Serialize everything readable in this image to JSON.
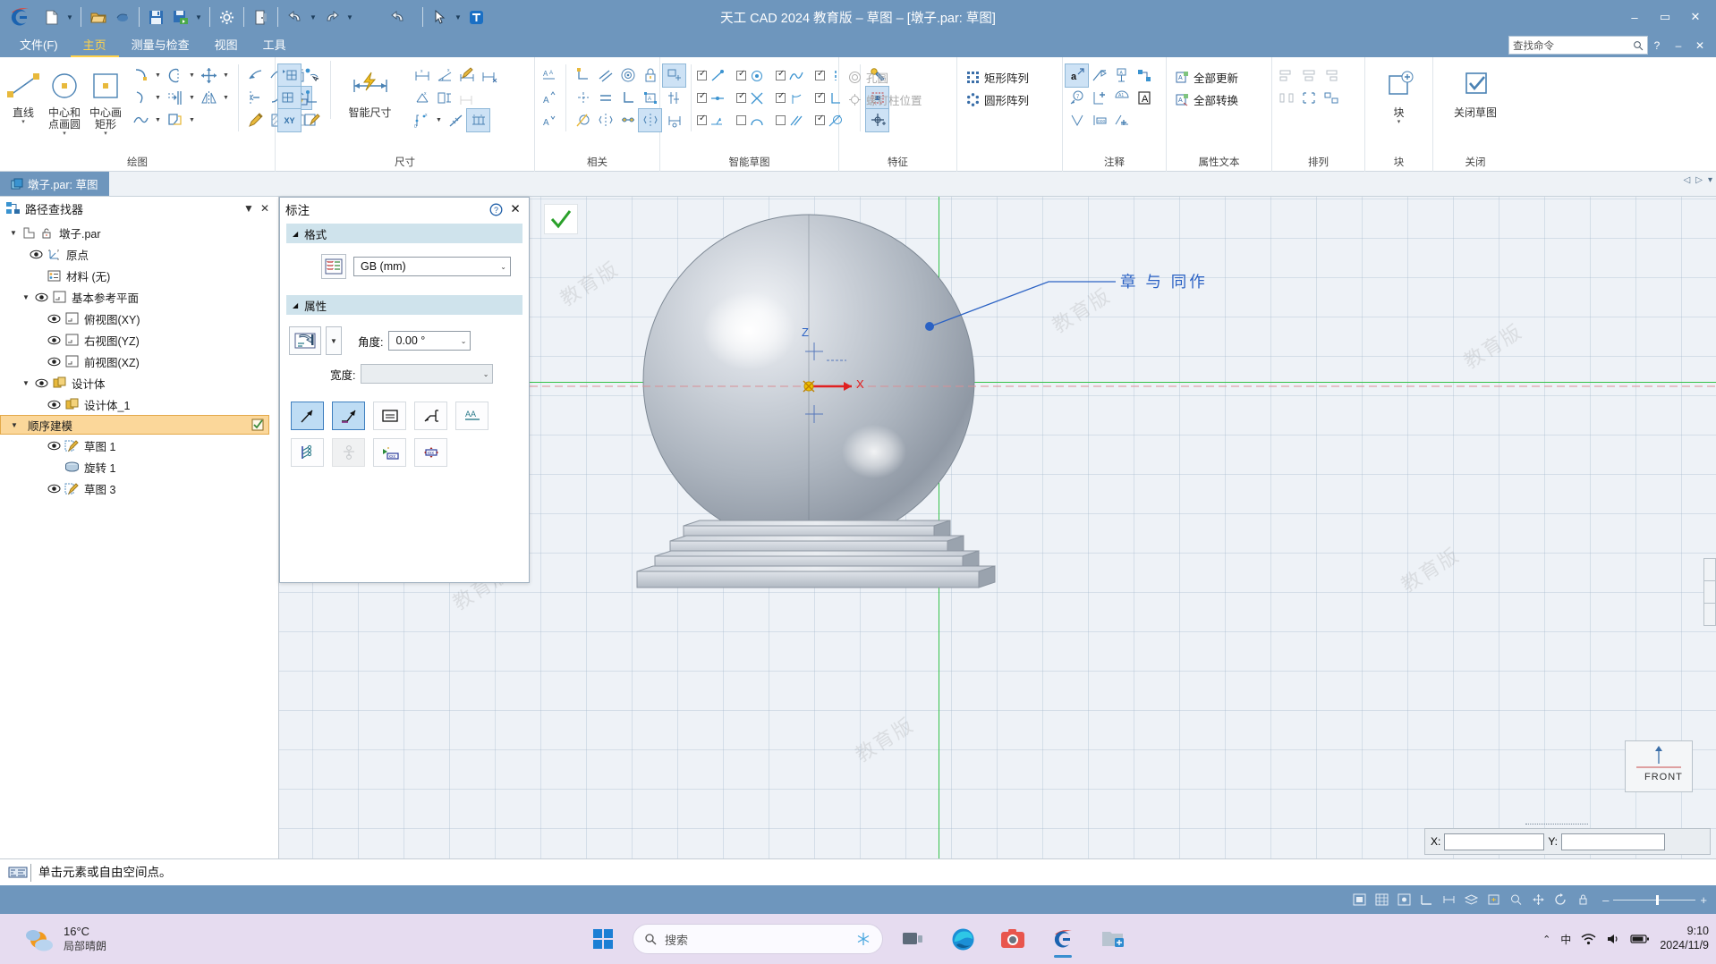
{
  "window": {
    "title": "天工 CAD 2024 教育版 – 草图 – [墩子.par: 草图]",
    "minimize": "–",
    "maximize": "▭",
    "close": "✕"
  },
  "quick_access": {
    "items": [
      {
        "name": "new-document",
        "icon": "page-icon"
      },
      {
        "name": "new-dropdown",
        "icon": "chevron-down-icon"
      },
      {
        "name": "open-document",
        "icon": "folder-open-icon"
      },
      {
        "name": "open-recent",
        "icon": "cloud-icon"
      },
      {
        "name": "save",
        "icon": "floppy-icon"
      },
      {
        "name": "save-as",
        "icon": "save-as-icon"
      },
      {
        "name": "save-dropdown",
        "icon": "chevron-down-icon"
      },
      {
        "name": "settings",
        "icon": "gear-icon"
      },
      {
        "name": "exit",
        "icon": "door-icon"
      },
      {
        "name": "undo",
        "icon": "undo-icon"
      },
      {
        "name": "undo-dropdown",
        "icon": "chevron-down-icon"
      },
      {
        "name": "redo",
        "icon": "redo-icon"
      },
      {
        "name": "redo-dropdown",
        "icon": "chevron-down-icon"
      },
      {
        "name": "undo-all",
        "icon": "undo-all-icon"
      },
      {
        "name": "select-tool",
        "icon": "cursor-icon"
      },
      {
        "name": "select-dropdown",
        "icon": "chevron-down-icon"
      },
      {
        "name": "text-tool",
        "icon": "text-t-icon"
      }
    ]
  },
  "menu": {
    "items": [
      {
        "label": "文件(F)",
        "active": false
      },
      {
        "label": "主页",
        "active": true
      },
      {
        "label": "测量与检查",
        "active": false
      },
      {
        "label": "视图",
        "active": false
      },
      {
        "label": "工具",
        "active": false
      }
    ],
    "search_placeholder": "查找命令",
    "help_icon": "question-icon",
    "restore_icon": "restore-icon",
    "close_icon": "close-icon"
  },
  "ribbon": {
    "groups": [
      {
        "name": "draw",
        "label": "绘图",
        "big_buttons": [
          {
            "label": "直线",
            "icon": "line-icon",
            "caret": "▾"
          },
          {
            "label": "中心和点画圆",
            "icon": "circle-center-point-icon",
            "caret": "▾"
          },
          {
            "label": "中心画矩形",
            "icon": "rectangle-center-icon",
            "caret": "▾"
          }
        ],
        "small_icons": [
          {
            "name": "arc-tangent-icon",
            "dropdown": true
          },
          {
            "name": "arc-3point-icon",
            "dropdown": true
          },
          {
            "name": "curve-icon",
            "dropdown": true
          },
          {
            "name": "ellipse-icon",
            "dropdown": true
          },
          {
            "name": "offset-icon",
            "dropdown": true
          },
          {
            "name": "fill-region-icon",
            "dropdown": true
          },
          {
            "name": "move-icon",
            "dropdown": true
          },
          {
            "name": "mirror-icon",
            "dropdown": true
          }
        ],
        "edit_icons": [
          {
            "name": "trim-icon"
          },
          {
            "name": "delete-trim-icon"
          },
          {
            "name": "fillet-corner-icon"
          },
          {
            "name": "extend-icon"
          },
          {
            "name": "stretch-icon"
          },
          {
            "name": "convert-icon",
            "selected": true
          },
          {
            "name": "edit-pencil-icon"
          },
          {
            "name": "hatch-icon"
          },
          {
            "name": "erase-icon"
          }
        ]
      },
      {
        "name": "dimension",
        "label": "尺寸",
        "plane_icons": [
          {
            "name": "plane-new-icon"
          },
          {
            "name": "plane-select-icon"
          },
          {
            "name": "plane-xy-icon",
            "label": "XY"
          },
          {
            "name": "point-select-icon"
          },
          {
            "name": "axis-lock-icon"
          },
          {
            "name": "sketch-edit-icon"
          }
        ],
        "big_buttons": [
          {
            "label": "智能尺寸",
            "icon": "smart-dimension-icon"
          }
        ],
        "small_icons": [
          {
            "name": "distance-between-icon"
          },
          {
            "name": "angle-between-icon"
          },
          {
            "name": "dimension-edit-icon"
          },
          {
            "name": "coordinate-dim-icon"
          },
          {
            "name": "symmetric-dim-icon"
          },
          {
            "name": "chain-dim-icon"
          },
          {
            "name": "baseline-dim-icon"
          },
          {
            "name": "xy-coordinate-icon",
            "dropdown": true
          },
          {
            "name": "dimension-style-icon"
          },
          {
            "name": "dimension-grid-icon",
            "selected": true
          }
        ]
      },
      {
        "name": "relations",
        "label": "相关",
        "text_icons": [
          {
            "name": "text-align-a-icon"
          },
          {
            "name": "text-superscript-icon"
          },
          {
            "name": "text-subscript-icon"
          }
        ],
        "small_icons": [
          {
            "name": "connect-icon"
          },
          {
            "name": "parallel-icon"
          },
          {
            "name": "concentric-icon"
          },
          {
            "name": "lock-icon"
          },
          {
            "name": "horizontal-vertical-icon"
          },
          {
            "name": "equal-icon"
          },
          {
            "name": "perpendicular-icon"
          },
          {
            "name": "rigid-set-icon"
          },
          {
            "name": "tangent-icon"
          },
          {
            "name": "symmetric-icon"
          },
          {
            "name": "collinear-icon"
          },
          {
            "name": "symmetric-axis-icon"
          },
          {
            "name": "relation-assistant-icon",
            "selected": true
          }
        ]
      },
      {
        "name": "smart-sketch",
        "label": "智能草图",
        "checkboxes": [
          {
            "name": "endpoint",
            "icon": "endpoint-icon",
            "checked": true
          },
          {
            "name": "center",
            "icon": "center-point-icon",
            "checked": true
          },
          {
            "name": "curve",
            "icon": "curve-point-icon",
            "checked": true
          },
          {
            "name": "vertical",
            "icon": "vertical-line-icon",
            "checked": true
          },
          {
            "name": "midpoint",
            "icon": "midpoint-icon",
            "checked": true
          },
          {
            "name": "intersection",
            "icon": "intersection-icon",
            "checked": true
          },
          {
            "name": "tangent-pt",
            "icon": "tangent-point-icon",
            "checked": true
          },
          {
            "name": "perpendicular-pt",
            "icon": "perpendicular-point-icon",
            "checked": true
          },
          {
            "name": "edge-point",
            "icon": "edge-point-icon",
            "checked": true
          },
          {
            "name": "arc-point",
            "icon": "arc-point-icon",
            "checked": false
          },
          {
            "name": "parallel-pt",
            "icon": "parallel-lines-icon",
            "checked": false
          },
          {
            "name": "angle-pt",
            "icon": "angle-point-icon",
            "checked": true
          }
        ],
        "tool_icons": [
          {
            "name": "smart-assistant-icon"
          },
          {
            "name": "region-select-icon",
            "selected": true
          },
          {
            "name": "origin-point-icon",
            "selected": true
          }
        ]
      },
      {
        "name": "feature",
        "label": "特征",
        "text_buttons": [
          {
            "label": "孔圆",
            "icon": "hole-circle-icon",
            "disabled": true
          },
          {
            "label": "螺钉柱位置",
            "icon": "screw-boss-icon",
            "disabled": true
          }
        ]
      },
      {
        "name": "pattern",
        "label": "",
        "text_buttons": [
          {
            "label": "矩形阵列",
            "icon": "rect-pattern-icon",
            "disabled": false
          },
          {
            "label": "圆形阵列",
            "icon": "circ-pattern-icon",
            "disabled": false
          }
        ]
      },
      {
        "name": "annotation",
        "label": "注释",
        "small_icons": [
          {
            "name": "annotation-a-icon",
            "selected": true
          },
          {
            "name": "leader-icon"
          },
          {
            "name": "balloon-icon"
          },
          {
            "name": "callout-icon"
          },
          {
            "name": "surface-finish-icon"
          },
          {
            "name": "datum-icon"
          },
          {
            "name": "weld-icon"
          },
          {
            "name": "text-box-a-icon"
          },
          {
            "name": "feature-control-icon"
          },
          {
            "name": "note-icon"
          },
          {
            "name": "edge-condition-icon"
          }
        ]
      },
      {
        "name": "property-text",
        "label": "属性文本",
        "text_buttons": [
          {
            "label": "全部更新",
            "icon": "update-all-icon"
          },
          {
            "label": "全部转换",
            "icon": "convert-all-icon"
          }
        ]
      },
      {
        "name": "arrange",
        "label": "排列",
        "small_icons": [
          {
            "name": "align-left-icon"
          },
          {
            "name": "align-center-icon"
          },
          {
            "name": "align-right-icon"
          },
          {
            "name": "distribute-icon"
          },
          {
            "name": "group-icon"
          },
          {
            "name": "ungroup-icon"
          }
        ]
      },
      {
        "name": "block",
        "label": "块",
        "big_buttons": [
          {
            "label": "块",
            "icon": "block-icon",
            "caret": "▾"
          }
        ],
        "sub_label": "块"
      },
      {
        "name": "close",
        "label": "关闭",
        "big_buttons": [
          {
            "label": "关闭草图",
            "icon": "close-sketch-icon"
          }
        ]
      }
    ]
  },
  "document_tabs": {
    "tabs": [
      {
        "label": "墩子.par: 草图",
        "icon": "document-icon",
        "active": true
      }
    ],
    "nav": [
      "◁",
      "▷",
      "▾"
    ]
  },
  "pathfinder": {
    "title": "路径查找器",
    "icon": "pathfinder-icon",
    "menu_icon": "menu-caret-icon",
    "close_icon": "close-icon",
    "tree": [
      {
        "label": "墩子.par",
        "depth": 0,
        "expander": "▼",
        "eye": false,
        "icon": "part-icon",
        "lock": true,
        "highlight": false
      },
      {
        "label": "原点",
        "depth": 1,
        "expander": "",
        "eye": true,
        "icon": "origin-icon",
        "highlight": false
      },
      {
        "label": "材料 (无)",
        "depth": 1,
        "expander": "",
        "eye": false,
        "icon": "material-icon",
        "highlight": false
      },
      {
        "label": "基本参考平面",
        "depth": 1,
        "expander": "▼",
        "eye": true,
        "icon": "plane-icon",
        "highlight": false
      },
      {
        "label": "俯视图(XY)",
        "depth": 2,
        "expander": "",
        "eye": true,
        "icon": "plane-icon",
        "highlight": false
      },
      {
        "label": "右视图(YZ)",
        "depth": 2,
        "expander": "",
        "eye": true,
        "icon": "plane-icon",
        "highlight": false
      },
      {
        "label": "前视图(XZ)",
        "depth": 2,
        "expander": "",
        "eye": true,
        "icon": "plane-icon",
        "highlight": false
      },
      {
        "label": "设计体",
        "depth": 1,
        "expander": "▼",
        "eye": true,
        "icon": "body-icon",
        "highlight": false
      },
      {
        "label": "设计体_1",
        "depth": 2,
        "expander": "",
        "eye": true,
        "icon": "body-icon",
        "highlight": false
      },
      {
        "label": "顺序建模",
        "depth": 1,
        "expander": "▼",
        "eye": false,
        "icon": "",
        "highlight": true,
        "badge": "check-icon"
      },
      {
        "label": "草图 1",
        "depth": 2,
        "expander": "",
        "eye": true,
        "icon": "sketch-icon",
        "highlight": false
      },
      {
        "label": "旋转 1",
        "depth": 2,
        "expander": "",
        "eye": false,
        "icon": "revolve-icon",
        "highlight": false
      },
      {
        "label": "草图 3",
        "depth": 2,
        "expander": "",
        "eye": true,
        "icon": "sketch-icon",
        "highlight": false
      }
    ]
  },
  "dialog": {
    "title": "标注",
    "help_icon": "question-icon",
    "close_icon": "close-icon",
    "sections": [
      {
        "label": "格式",
        "tri": "◢"
      },
      {
        "label": "属性",
        "tri": "◢"
      }
    ],
    "format": {
      "style_button_icon": "dim-style-icon",
      "standard_value": "GB (mm)",
      "caret": "⌄"
    },
    "properties": {
      "style_button_icon": "annotation-style-icon",
      "style_dropdown_caret": "▾",
      "angle_label": "角度:",
      "angle_value": "0.00 °",
      "angle_caret": "⌄",
      "width_label": "宽度:",
      "width_value": "",
      "width_caret": "⌄"
    },
    "toggle_buttons": [
      {
        "name": "leader-arrow",
        "icon": "arrow-leader-icon",
        "state": "on"
      },
      {
        "name": "leader-with-shoulder",
        "icon": "arrow-shoulder-icon",
        "state": "on"
      },
      {
        "name": "text-frame",
        "icon": "text-frame-icon",
        "state": "normal"
      },
      {
        "name": "leader-break",
        "icon": "leader-break-icon",
        "state": "normal"
      },
      {
        "name": "text-underline",
        "icon": "text-underline-icon",
        "state": "normal"
      },
      {
        "name": "multi-leader",
        "icon": "multi-leader-icon",
        "state": "normal"
      },
      {
        "name": "balloon-stack",
        "icon": "balloon-stack-icon",
        "state": "disabled"
      },
      {
        "name": "text-insert",
        "icon": "text-insert-icon",
        "state": "normal"
      },
      {
        "name": "text-align-grips",
        "icon": "text-grips-icon",
        "state": "normal"
      }
    ],
    "accept_button": {
      "name": "accept",
      "icon": "green-check-icon"
    }
  },
  "canvas": {
    "annotation_text": "章 与 同作",
    "axis_label_x": "X",
    "axis_label_z": "Z",
    "view_cube_label": "FRONT",
    "watermarks": [
      "教育版",
      "教育版",
      "教育版",
      "教育版",
      "教育版",
      "教育版"
    ],
    "coord_bar": {
      "x_label": "X:",
      "x_value": "",
      "y_label": "Y:",
      "y_value": ""
    },
    "colors": {
      "grid": "#a0b4c8",
      "axis_x": "#e04040",
      "axis_green": "#35c24a",
      "annotation": "#2b62c4",
      "sphere_light": "#e8ebef",
      "sphere_mid": "#9ba5b2",
      "base": "#c3cad3"
    }
  },
  "status_bar": {
    "icon": "prompt-icon",
    "message": "单击元素或自由空间点。",
    "right_icons": [
      "select-icon",
      "grid-icon",
      "snap-icon",
      "ortho-icon",
      "dim-icon",
      "layer-icon",
      "fit-icon",
      "zoom-icon",
      "pan-icon",
      "rotate-icon",
      "lock-icon"
    ],
    "zoom_minus": "–",
    "zoom_plus": "+"
  },
  "taskbar": {
    "weather": {
      "temperature": "16°C",
      "condition": "局部晴朗",
      "icon": "partly-cloudy-icon"
    },
    "start_icon": "windows-icon",
    "search_placeholder": "搜索",
    "search_extra_icon": "snowflake-icon",
    "apps": [
      {
        "name": "task-view",
        "icon": "taskview-icon",
        "active": false
      },
      {
        "name": "edge-browser",
        "icon": "edge-icon",
        "active": false
      },
      {
        "name": "camera-app",
        "icon": "camera-icon",
        "active": false
      },
      {
        "name": "tiangong-cad",
        "icon": "cad-logo-icon",
        "active": true
      },
      {
        "name": "file-explorer",
        "icon": "explorer-icon",
        "active": false
      }
    ],
    "tray": {
      "chevron": "⌃",
      "ime": "中",
      "wifi_icon": "wifi-icon",
      "volume_icon": "volume-icon",
      "battery_icon": "battery-icon",
      "time": "9:10",
      "date": "2024/11/9"
    }
  }
}
